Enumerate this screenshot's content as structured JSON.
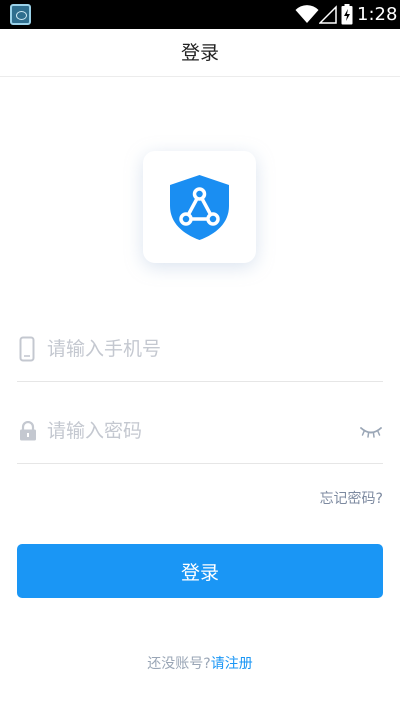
{
  "status_bar": {
    "time": "1:28",
    "icons": [
      "app-icon",
      "wifi-icon",
      "signal-icon",
      "battery-charging-icon"
    ]
  },
  "header": {
    "title": "登录"
  },
  "logo": {
    "icon": "shield-network-icon",
    "color": "#1a8ef2"
  },
  "form": {
    "phone": {
      "placeholder": "请输入手机号",
      "value": "",
      "icon": "phone-icon"
    },
    "password": {
      "placeholder": "请输入密码",
      "value": "",
      "icon": "lock-icon",
      "toggle_icon": "eye-closed-icon"
    },
    "forgot_label": "忘记密码?",
    "login_label": "登录"
  },
  "register": {
    "prompt": "还没账号?",
    "link_label": "请注册"
  },
  "colors": {
    "accent": "#1a96f5",
    "placeholder": "#c4c8d0",
    "muted_text": "#7d8aa0"
  }
}
